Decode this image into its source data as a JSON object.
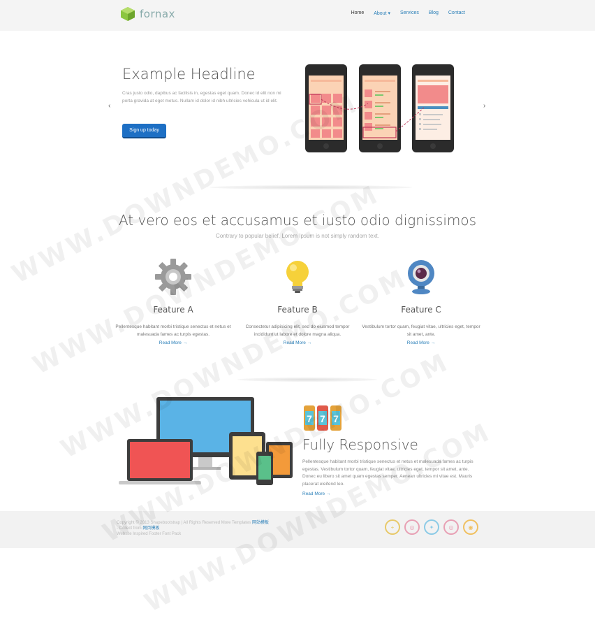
{
  "brand": {
    "name": "fornax",
    "color": "#8cc63f"
  },
  "nav": {
    "items": [
      {
        "label": "Home",
        "active": true
      },
      {
        "label": "About ▾",
        "active": false
      },
      {
        "label": "Services",
        "active": false
      },
      {
        "label": "Blog",
        "active": false
      },
      {
        "label": "Contact",
        "active": false
      }
    ]
  },
  "hero": {
    "title": "Example Headline",
    "text": "Cras justo odio, dapibus ac facilisis in, egestas eget quam. Donec id elit non mi porta gravida at eget metus. Nullam id dolor id nibh ultricies vehicula ut id elit.",
    "button": "Sign up today",
    "prev_arrow": "‹",
    "next_arrow": "›"
  },
  "features_section": {
    "title": "At vero eos et accusamus et iusto odio dignissimos",
    "subtitle": "Contrary to popular belief, Lorem Ipsum is not simply random text.",
    "features": [
      {
        "icon": "gear-icon",
        "title": "Feature A",
        "text": "Pellentesque habitant morbi tristique senectus et netus et malesuada fames ac turpis egestas.",
        "link": "Read More →"
      },
      {
        "icon": "lightbulb-icon",
        "title": "Feature B",
        "text": "Consectetur adipisicing elit, sed do eiusmod tempor incididunt ut labore et dolore magna aliqua.",
        "link": "Read More →"
      },
      {
        "icon": "webcam-icon",
        "title": "Feature C",
        "text": "Vestibulum tortor quam, feugiat vitae, ultricies eget, tempor sit amet, ante.",
        "link": "Read More →"
      }
    ]
  },
  "responsive": {
    "title": "Fully Responsive",
    "text": "Pellentesque habitant morbi tristique senectus et netus et malesuada fames ac turpis egestas. Vestibulum tortor quam, feugiat vitae, ultricies eget, tempor sit amet, ante. Donec eu libero sit amet quam egestas semper. Aenean ultricies mi vitae est. Mauris placerat eleifend leo.",
    "link": "Read More →",
    "slot_digits": [
      "7",
      "7",
      "7"
    ]
  },
  "footer": {
    "copyright": "Copyright © 2013 Shapebootstrap | All Rights Reserved  More Templates",
    "copyright_link": "网站模板",
    "collect": "- Collect from",
    "collect_link": "网页模板",
    "line3": "Website Inspired Footer Font Pack",
    "socials": [
      {
        "icon": "plus-icon",
        "glyph": "+",
        "color": "#e8c96a"
      },
      {
        "icon": "dribbble-icon",
        "glyph": "◎",
        "color": "#e8a0b4"
      },
      {
        "icon": "twitter-icon",
        "glyph": "✦",
        "color": "#8ccbe6"
      },
      {
        "icon": "dribbble-icon",
        "glyph": "◎",
        "color": "#e8a0b4"
      },
      {
        "icon": "rss-icon",
        "glyph": "◉",
        "color": "#f0c060"
      }
    ]
  },
  "watermark": "WWW.DOWNDEMO.COM"
}
